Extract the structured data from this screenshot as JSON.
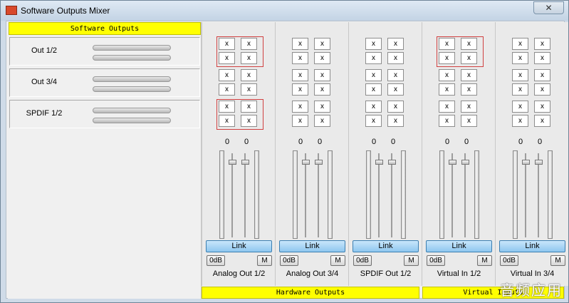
{
  "window": {
    "title": "Software Outputs Mixer",
    "close_glyph": "✕",
    "app_icon": "mixer-app-icon"
  },
  "software_outputs": {
    "header": "Software Outputs",
    "rows": [
      {
        "label": "Out 1/2"
      },
      {
        "label": "Out 3/4"
      },
      {
        "label": "SPDIF 1/2"
      }
    ]
  },
  "matrix_cell": "x",
  "channels": [
    {
      "name": "Analog Out 1/2",
      "left_value": "0",
      "right_value": "0",
      "link": "Link",
      "zero_db": "0dB",
      "mute": "M",
      "highlighted_groups": [
        0,
        2
      ]
    },
    {
      "name": "Analog Out 3/4",
      "left_value": "0",
      "right_value": "0",
      "link": "Link",
      "zero_db": "0dB",
      "mute": "M",
      "highlighted_groups": []
    },
    {
      "name": "SPDIF Out 1/2",
      "left_value": "0",
      "right_value": "0",
      "link": "Link",
      "zero_db": "0dB",
      "mute": "M",
      "highlighted_groups": []
    },
    {
      "name": "Virtual In 1/2",
      "left_value": "0",
      "right_value": "0",
      "link": "Link",
      "zero_db": "0dB",
      "mute": "M",
      "highlighted_groups": [
        0
      ]
    },
    {
      "name": "Virtual In 3/4",
      "left_value": "0",
      "right_value": "0",
      "link": "Link",
      "zero_db": "0dB",
      "mute": "M",
      "highlighted_groups": []
    }
  ],
  "footer": {
    "hardware_outputs": "Hardware Outputs",
    "virtual_inputs": "Virtual Inputs"
  },
  "watermark": "音频应用",
  "colors": {
    "header_yellow": "#ffff00",
    "highlight_red": "#d04040",
    "link_blue": "#8ec7ef"
  }
}
